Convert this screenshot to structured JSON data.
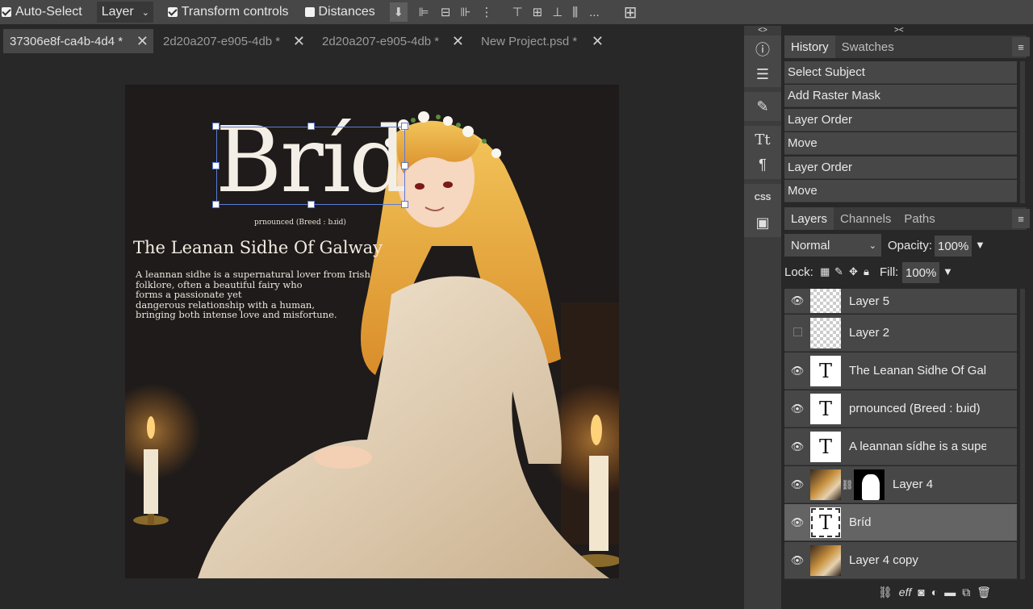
{
  "toolbar": {
    "auto_select_label": "Auto-Select",
    "auto_select_checked": true,
    "layer_dropdown": "Layer",
    "transform_controls_label": "Transform controls",
    "transform_controls_checked": true,
    "distances_label": "Distances",
    "distances_checked": false,
    "more_label": "..."
  },
  "tabs": [
    {
      "label": "37306e8f-ca4b-4d4 *",
      "active": true
    },
    {
      "label": "2d20a207-e905-4db *",
      "active": false
    },
    {
      "label": "2d20a207-e905-4db *",
      "active": false
    },
    {
      "label": "New Project.psd *",
      "active": false
    }
  ],
  "artwork": {
    "title": "Bríd",
    "pronunciation": "prnounced (Breed : bɹid)",
    "heading": "The Leanan Sidhe Of Galway",
    "body_lines": [
      "A leannan sidhe is a supernatural lover from Irish",
      " folklore, often a beautiful fairy who",
      "forms a passionate yet",
      "dangerous relationship with a human,",
      "bringing both intense love and misfortune."
    ]
  },
  "tool_strip": {
    "top_label": "<>",
    "icons": [
      "info-icon",
      "adjust-icon",
      "brush-icon",
      "character-icon",
      "paragraph-icon",
      "css-icon",
      "image-icon"
    ],
    "css_label": "CSS"
  },
  "panels": {
    "top_label": "><",
    "history": {
      "tabs": [
        "History",
        "Swatches"
      ],
      "items": [
        "Select Subject",
        "Add Raster Mask",
        "Layer Order",
        "Move",
        "Layer Order",
        "Move"
      ]
    },
    "layers": {
      "tabs": [
        "Layers",
        "Channels",
        "Paths"
      ],
      "blend_mode": "Normal",
      "opacity_label": "Opacity:",
      "opacity_value": "100%",
      "lock_label": "Lock:",
      "fill_label": "Fill:",
      "fill_value": "100%",
      "items": [
        {
          "name": "Layer 5",
          "kind": "transparent",
          "visible": true,
          "selected": false
        },
        {
          "name": "Layer 2",
          "kind": "transparent",
          "visible": false,
          "selected": false
        },
        {
          "name": "The Leanan Sidhe Of Galway",
          "kind": "text",
          "visible": true,
          "selected": false
        },
        {
          "name": "prnounced (Breed : bɹid)",
          "kind": "text",
          "visible": true,
          "selected": false
        },
        {
          "name": "A leannan sídhe is a supernatural",
          "kind": "text",
          "visible": true,
          "selected": false
        },
        {
          "name": "Layer 4",
          "kind": "photo-mask",
          "visible": true,
          "selected": false
        },
        {
          "name": "Bríd",
          "kind": "text",
          "visible": true,
          "selected": true
        },
        {
          "name": "Layer 4 copy",
          "kind": "photo",
          "visible": true,
          "selected": false
        }
      ],
      "footer_fx_label": "eff"
    }
  }
}
